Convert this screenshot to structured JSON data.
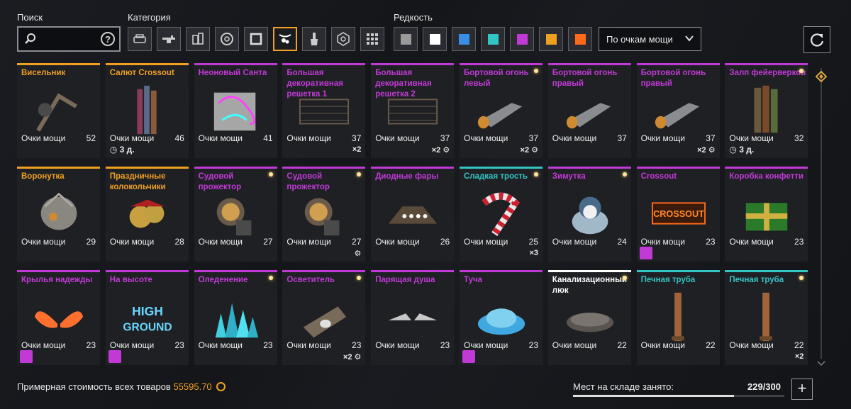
{
  "filters": {
    "search_label": "Поиск",
    "search_value": "",
    "category_label": "Категория",
    "rarity_label": "Редкость",
    "sort_value": "По очкам мощи",
    "categories": [
      "cabin-icon",
      "weapon-icon",
      "module-icon",
      "wheel-icon",
      "frame-icon",
      "decor-icon",
      "paint-icon",
      "sticker-icon",
      "grid-icon"
    ],
    "selected_category": 5,
    "rarities": [
      "#9a9a9a",
      "#ffffff",
      "#3a8ee6",
      "#33c4c4",
      "#c23ad6",
      "#f0a020",
      "#ff6a1a"
    ]
  },
  "points_label": "Очки мощи",
  "items": [
    {
      "name": "Висельник",
      "rarity": "#f0a020",
      "points": "52",
      "extra": "",
      "timer": "",
      "badge": false,
      "dot": false
    },
    {
      "name": "Салют Crossout",
      "rarity": "#f0a020",
      "points": "46",
      "extra": "",
      "timer": "3 д.",
      "badge": false,
      "dot": false
    },
    {
      "name": "Неоновый Санта",
      "rarity": "#c23ad6",
      "points": "41",
      "extra": "",
      "timer": "",
      "badge": false,
      "dot": false
    },
    {
      "name": "Большая декоративная решетка 1",
      "rarity": "#c23ad6",
      "points": "37",
      "extra": "×2",
      "timer": "",
      "badge": false,
      "dot": false
    },
    {
      "name": "Большая декоративная решетка 2",
      "rarity": "#c23ad6",
      "points": "37",
      "extra": "×2 ⚙",
      "timer": "",
      "badge": false,
      "dot": false
    },
    {
      "name": "Бортовой огонь левый",
      "rarity": "#c23ad6",
      "points": "37",
      "extra": "×2 ⚙",
      "timer": "",
      "badge": false,
      "dot": true
    },
    {
      "name": "Бортовой огонь правый",
      "rarity": "#c23ad6",
      "points": "37",
      "extra": "",
      "timer": "",
      "badge": false,
      "dot": false
    },
    {
      "name": "Бортовой огонь правый",
      "rarity": "#c23ad6",
      "points": "37",
      "extra": "×2 ⚙",
      "timer": "",
      "badge": false,
      "dot": false
    },
    {
      "name": "Залп фейерверков",
      "rarity": "#c23ad6",
      "points": "32",
      "extra": "",
      "timer": "3 д.",
      "badge": false,
      "dot": true
    },
    {
      "name": "Воронутка",
      "rarity": "#f0a020",
      "points": "29",
      "extra": "",
      "timer": "",
      "badge": false,
      "dot": false
    },
    {
      "name": "Праздничные колокольчики",
      "rarity": "#f0a020",
      "points": "28",
      "extra": "",
      "timer": "",
      "badge": false,
      "dot": false
    },
    {
      "name": "Судовой прожектор",
      "rarity": "#c23ad6",
      "points": "27",
      "extra": "",
      "timer": "",
      "badge": false,
      "dot": true
    },
    {
      "name": "Судовой прожектор",
      "rarity": "#c23ad6",
      "points": "27",
      "extra": "⚙",
      "timer": "",
      "badge": false,
      "dot": true
    },
    {
      "name": "Диодные фары",
      "rarity": "#c23ad6",
      "points": "26",
      "extra": "",
      "timer": "",
      "badge": false,
      "dot": false
    },
    {
      "name": "Сладкая трость",
      "rarity": "#33c4c4",
      "points": "25",
      "extra": "×3",
      "timer": "",
      "badge": false,
      "dot": true
    },
    {
      "name": "Зимутка",
      "rarity": "#c23ad6",
      "points": "24",
      "extra": "",
      "timer": "",
      "badge": false,
      "dot": true
    },
    {
      "name": "Crossout",
      "rarity": "#c23ad6",
      "points": "23",
      "extra": "",
      "timer": "",
      "badge": true,
      "dot": false
    },
    {
      "name": "Коробка конфетти",
      "rarity": "#c23ad6",
      "points": "23",
      "extra": "",
      "timer": "",
      "badge": false,
      "dot": false
    },
    {
      "name": "Крылья надежды",
      "rarity": "#c23ad6",
      "points": "23",
      "extra": "",
      "timer": "",
      "badge": true,
      "dot": false
    },
    {
      "name": "На высоте",
      "rarity": "#c23ad6",
      "points": "23",
      "extra": "",
      "timer": "",
      "badge": true,
      "dot": false
    },
    {
      "name": "Оледенение",
      "rarity": "#c23ad6",
      "points": "23",
      "extra": "",
      "timer": "",
      "badge": false,
      "dot": true
    },
    {
      "name": "Осветитель",
      "rarity": "#c23ad6",
      "points": "23",
      "extra": "×2 ⚙",
      "timer": "",
      "badge": false,
      "dot": true
    },
    {
      "name": "Парящая душа",
      "rarity": "#c23ad6",
      "points": "23",
      "extra": "",
      "timer": "",
      "badge": false,
      "dot": false
    },
    {
      "name": "Туча",
      "rarity": "#c23ad6",
      "points": "23",
      "extra": "",
      "timer": "",
      "badge": true,
      "dot": false
    },
    {
      "name": "Канализационный люк",
      "rarity": "#ffffff",
      "points": "22",
      "extra": "",
      "timer": "",
      "badge": false,
      "dot": true
    },
    {
      "name": "Печная труба",
      "rarity": "#33c4c4",
      "points": "22",
      "extra": "",
      "timer": "",
      "badge": false,
      "dot": false
    },
    {
      "name": "Печная труба",
      "rarity": "#33c4c4",
      "points": "22",
      "extra": "×2",
      "timer": "",
      "badge": false,
      "dot": true
    }
  ],
  "footer": {
    "cost_label": "Примерная стоимость всех товаров",
    "cost_value": "55595.70",
    "storage_label": "Мест на складе занято:",
    "storage_value": "229/300",
    "storage_fraction": 0.763
  }
}
